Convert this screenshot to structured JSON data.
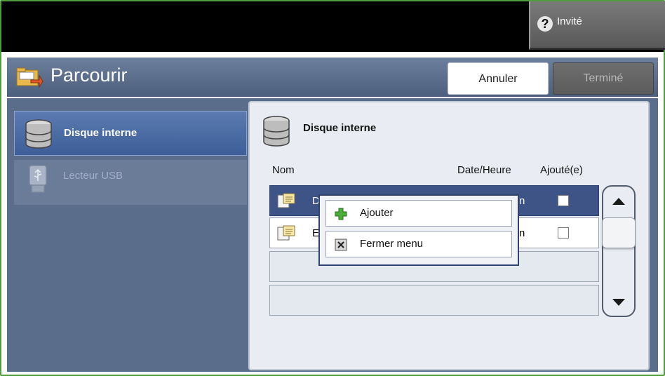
{
  "header": {
    "guest_label": "Invité",
    "guest_icon": "help-question-icon"
  },
  "titlebar": {
    "title": "Parcourir",
    "icon": "folder-browse-icon",
    "cancel_label": "Annuler",
    "done_label": "Terminé"
  },
  "sidebar": {
    "items": [
      {
        "label": "Disque interne",
        "icon": "hard-drive-icon",
        "selected": true
      },
      {
        "label": "Lecteur USB",
        "icon": "usb-drive-icon",
        "disabled": true
      }
    ]
  },
  "panel": {
    "title": "Disque interne",
    "icon": "hard-drive-icon",
    "columns": {
      "name": "Nom",
      "date": "Date/Heure",
      "added": "Ajouté(e)"
    },
    "rows": [
      {
        "name": "Dis",
        "date": "n",
        "checked": false,
        "selected": true
      },
      {
        "name": "En",
        "date": "n",
        "checked": false,
        "selected": false
      },
      {
        "name": "",
        "date": ""
      },
      {
        "name": "",
        "date": ""
      }
    ]
  },
  "context_menu": {
    "items": [
      {
        "label": "Ajouter",
        "icon": "plus-icon"
      },
      {
        "label": "Fermer menu",
        "icon": "close-icon"
      }
    ]
  },
  "colors": {
    "frame": "#4f9d3f",
    "title_bar": "#5a6d8b",
    "selected": "#3e5486"
  }
}
